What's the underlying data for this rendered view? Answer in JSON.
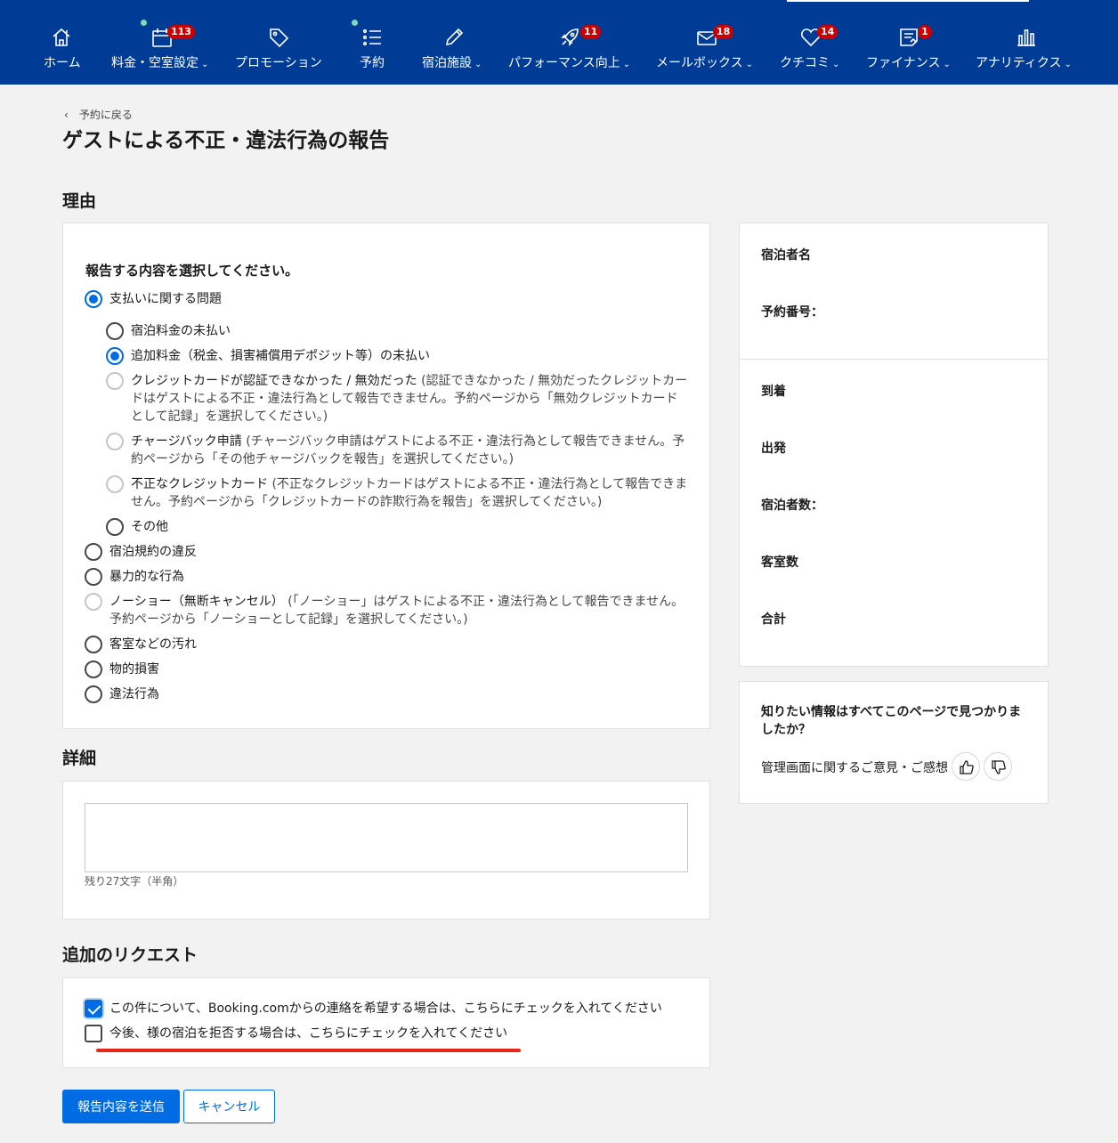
{
  "nav": {
    "items": [
      {
        "label": "ホーム",
        "icon": "home-icon",
        "dropdown": false
      },
      {
        "label": "料金・空室設定",
        "icon": "calendar-icon",
        "badge": "113",
        "dropdown": true
      },
      {
        "label": "プロモーション",
        "icon": "tag-icon",
        "dropdown": false
      },
      {
        "label": "予約",
        "icon": "list-icon",
        "dropdown": false
      },
      {
        "label": "宿泊施設",
        "icon": "pencil-icon",
        "dropdown": true
      },
      {
        "label": "パフォーマンス向上",
        "icon": "rocket-icon",
        "badge": "11",
        "dropdown": true
      },
      {
        "label": "メールボックス",
        "icon": "mail-icon",
        "badge": "18",
        "dropdown": true
      },
      {
        "label": "クチコミ",
        "icon": "heart-icon",
        "badge": "14",
        "dropdown": true
      },
      {
        "label": "ファイナンス",
        "icon": "invoice-icon",
        "badge": "1",
        "dropdown": true
      },
      {
        "label": "アナリティクス",
        "icon": "bar-chart-icon",
        "dropdown": true
      }
    ],
    "chevron": "⌄",
    "badge_color": "#cc0000",
    "bar_color": "#003b95"
  },
  "page": {
    "back": "予約に戻る",
    "title": "ゲストによる不正・違法行為の報告"
  },
  "reason": {
    "section_title": "理由",
    "question": "報告する内容を選択してください。",
    "options": [
      {
        "label": "支払いに関する問題",
        "checked": true
      },
      {
        "label": "宿泊料金の未払い",
        "checked": false
      },
      {
        "label": "追加料金（税金、損害補償用デポジット等）の未払い",
        "checked": true
      },
      {
        "label": "クレジットカードが認証できなかった / 無効だった",
        "note": "(認証できなかった / 無効だったクレジットカードはゲストによる不正・違法行為として報告できません。予約ページから「無効クレジットカードとして記録」を選択してください。)",
        "disabled": true
      },
      {
        "label": "チャージバック申請",
        "note": "(チャージバック申請はゲストによる不正・違法行為として報告できません。予約ページから「その他チャージバックを報告」を選択してください。)",
        "disabled": true
      },
      {
        "label": "不正なクレジットカード",
        "note": "(不正なクレジットカードはゲストによる不正・違法行為として報告できません。予約ページから「クレジットカードの詐欺行為を報告」を選択してください。)",
        "disabled": true
      },
      {
        "label": "その他",
        "checked": false
      },
      {
        "label": "宿泊規約の違反",
        "checked": false
      },
      {
        "label": "暴力的な行為",
        "checked": false
      },
      {
        "label": "ノーショー（無断キャンセル）",
        "note": "(「ノーショー」はゲストによる不正・違法行為として報告できません。予約ページから「ノーショーとして記録」を選択してください。)",
        "disabled": true
      },
      {
        "label": "客室などの汚れ",
        "checked": false
      },
      {
        "label": "物的損害",
        "checked": false
      },
      {
        "label": "違法行為",
        "checked": false
      }
    ]
  },
  "details": {
    "section_title": "詳細",
    "value": "",
    "counter": "残り27文字（半角）"
  },
  "requests": {
    "section_title": "追加のリクエスト",
    "contact_label": "この件について、Booking.comからの連絡を希望する場合は、こちらにチェックを入れてください",
    "contact_checked": true,
    "refuse_label": "今後、様の宿泊を拒否する場合は、こちらにチェックを入れてください",
    "refuse_checked": false
  },
  "actions": {
    "submit": "報告内容を送信",
    "cancel": "キャンセル"
  },
  "summary": {
    "guest_name": "宿泊者名",
    "booking_number": "予約番号：",
    "arrival": "到着",
    "departure": "出発",
    "guests": "宿泊者数：",
    "rooms": "客室数",
    "total": "合計"
  },
  "feedback": {
    "title": "知りたい情報はすべてこのページで見つかりましたか？",
    "text": "管理画面に関するご意見・ご感想"
  }
}
